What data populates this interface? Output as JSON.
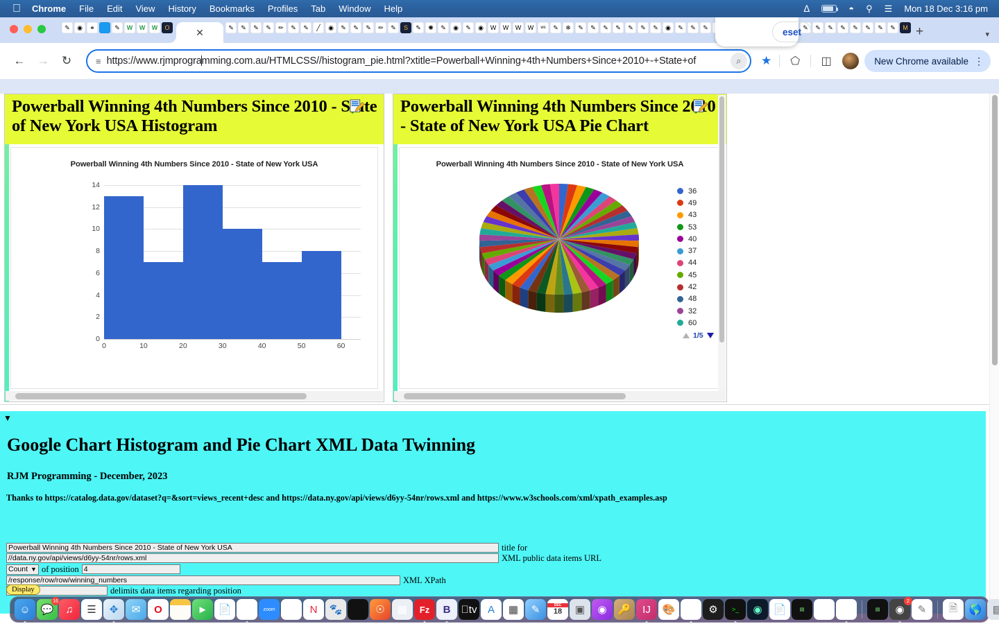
{
  "menubar": {
    "apple": "apple-logo",
    "items": [
      "Chrome",
      "File",
      "Edit",
      "View",
      "History",
      "Bookmarks",
      "Profiles",
      "Tab",
      "Window",
      "Help"
    ],
    "clock": "Mon 18 Dec  3:16 pm"
  },
  "browser": {
    "url": "https://www.rjmprogramming.com.au/HTMLCSS//histogram_pie.html?xtitle=Powerball+Winning+4th+Numbers+Since+2010+-+State+of",
    "url_before_caret": "https://www.rjmprogra",
    "url_after_caret": "mming.com.au/HTMLCSS//histogram_pie.html?xtitle=Powerball+Winning+4th+Numbers+Since+2010+-+State+of",
    "update_chip": "New Chrome available",
    "close_tab": "✕",
    "new_tab": "+",
    "tab_search": "▾"
  },
  "popup": {
    "reset_label": "eset"
  },
  "frames": {
    "left": {
      "heading": "Powerball Winning 4th Numbers Since 2010 - State of New York USA Histogram"
    },
    "right": {
      "heading": "Powerball Winning 4th Numbers Since 2010 - State of New York USA Pie Chart",
      "pager": "1/5"
    }
  },
  "chart_data": [
    {
      "type": "bar",
      "title": "Powerball Winning 4th Numbers Since 2010 - State of New York USA",
      "chart_kind": "histogram",
      "categories": [
        "0-10",
        "10-20",
        "20-30",
        "30-40",
        "40-50",
        "50-60"
      ],
      "values": [
        13,
        7,
        14,
        10,
        7,
        8
      ],
      "bar_color": "#3366cc",
      "xlabel": "",
      "ylabel": "",
      "xticks": [
        0,
        10,
        20,
        30,
        40,
        50,
        60
      ],
      "yticks": [
        0,
        2,
        4,
        6,
        8,
        10,
        12,
        14
      ],
      "xlim": [
        0,
        65
      ],
      "ylim": [
        0,
        14
      ],
      "grid": true,
      "legend": false
    },
    {
      "type": "pie",
      "title": "Powerball Winning 4th Numbers Since 2010 - State of New York USA",
      "three_d": true,
      "legend_position": "right",
      "legend_page": "1/5",
      "labels": [
        "36",
        "49",
        "43",
        "53",
        "40",
        "37",
        "44",
        "45",
        "42",
        "48",
        "32",
        "60"
      ],
      "colors": [
        "#3366cc",
        "#dc3912",
        "#ff9900",
        "#109618",
        "#990099",
        "#3b9bd5",
        "#dd4477",
        "#66aa00",
        "#b82e2e",
        "#316395",
        "#994499",
        "#22aa99"
      ],
      "values": [
        1,
        1,
        1,
        1,
        1,
        1,
        1,
        1,
        1,
        1,
        1,
        1
      ],
      "total_slices": 55
    }
  ],
  "content": {
    "caret": "▼",
    "h1": "Google Chart Histogram and Pie Chart XML Data Twinning",
    "h2": "RJM Programming - December, 2023",
    "thanks": "Thanks to https://catalog.data.gov/dataset?q=&sort=views_recent+desc and https://data.ny.gov/api/views/d6yy-54nr/rows.xml and https://www.w3schools.com/xml/xpath_examples.asp"
  },
  "form": {
    "title_value": "Powerball Winning 4th Numbers Since 2010 - State of New York USA",
    "title_label": "title for",
    "url_value": "//data.ny.gov/api/views/d6yy-54nr/rows.xml",
    "url_label": "XML public data items URL",
    "aggregate_value": "Count",
    "aggregate_caret": "▼",
    "position_label": "of position",
    "position_value": "4",
    "xpath_value": "/response/row/row/winning_numbers",
    "xpath_label": "XML XPath",
    "delimiter_value": "",
    "delimiter_label": "delimits data items regarding position",
    "display_button": "Display"
  },
  "dock": {
    "badge_messages": "16",
    "badge_notes": "2",
    "calendar_month": "DEC",
    "calendar_day": "18"
  }
}
